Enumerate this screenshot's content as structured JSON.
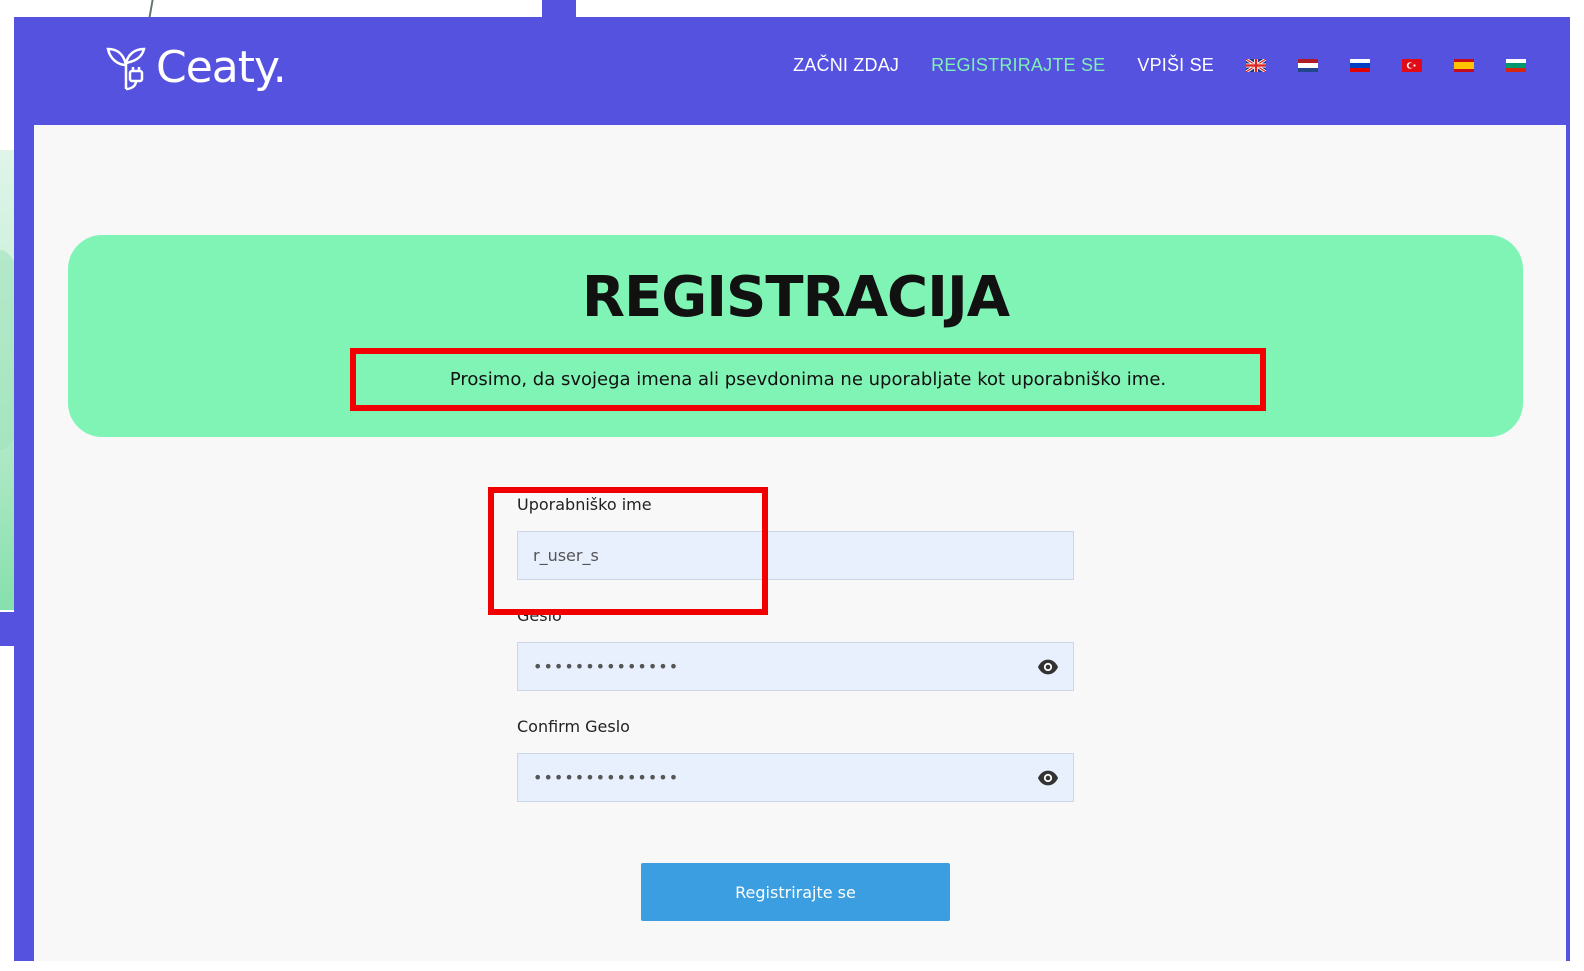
{
  "brand": {
    "name": "Ceaty."
  },
  "nav": {
    "links": [
      {
        "label": "ZAČNI ZDAJ"
      },
      {
        "label": "REGISTRIRAJTE SE"
      },
      {
        "label": "VPIŠI SE"
      }
    ]
  },
  "hero": {
    "title": "REGISTRACIJA",
    "note": "Prosimo, da svojega imena ali psevdonima ne uporabljate kot uporabniško ime."
  },
  "form": {
    "username": {
      "label": "Uporabniško ime",
      "value": "r_user_s"
    },
    "password": {
      "label": "Geslo",
      "value": "••••••••••••••"
    },
    "confirm": {
      "label": "Confirm Geslo",
      "value": "••••••••••••••"
    },
    "submit_label": "Registrirajte se"
  },
  "colors": {
    "header_bg": "#5652e0",
    "nav_active": "#7ff0b6",
    "hero_bg": "#7ff4b5",
    "highlight": "#f00000",
    "button_bg": "#3a9ee0"
  }
}
